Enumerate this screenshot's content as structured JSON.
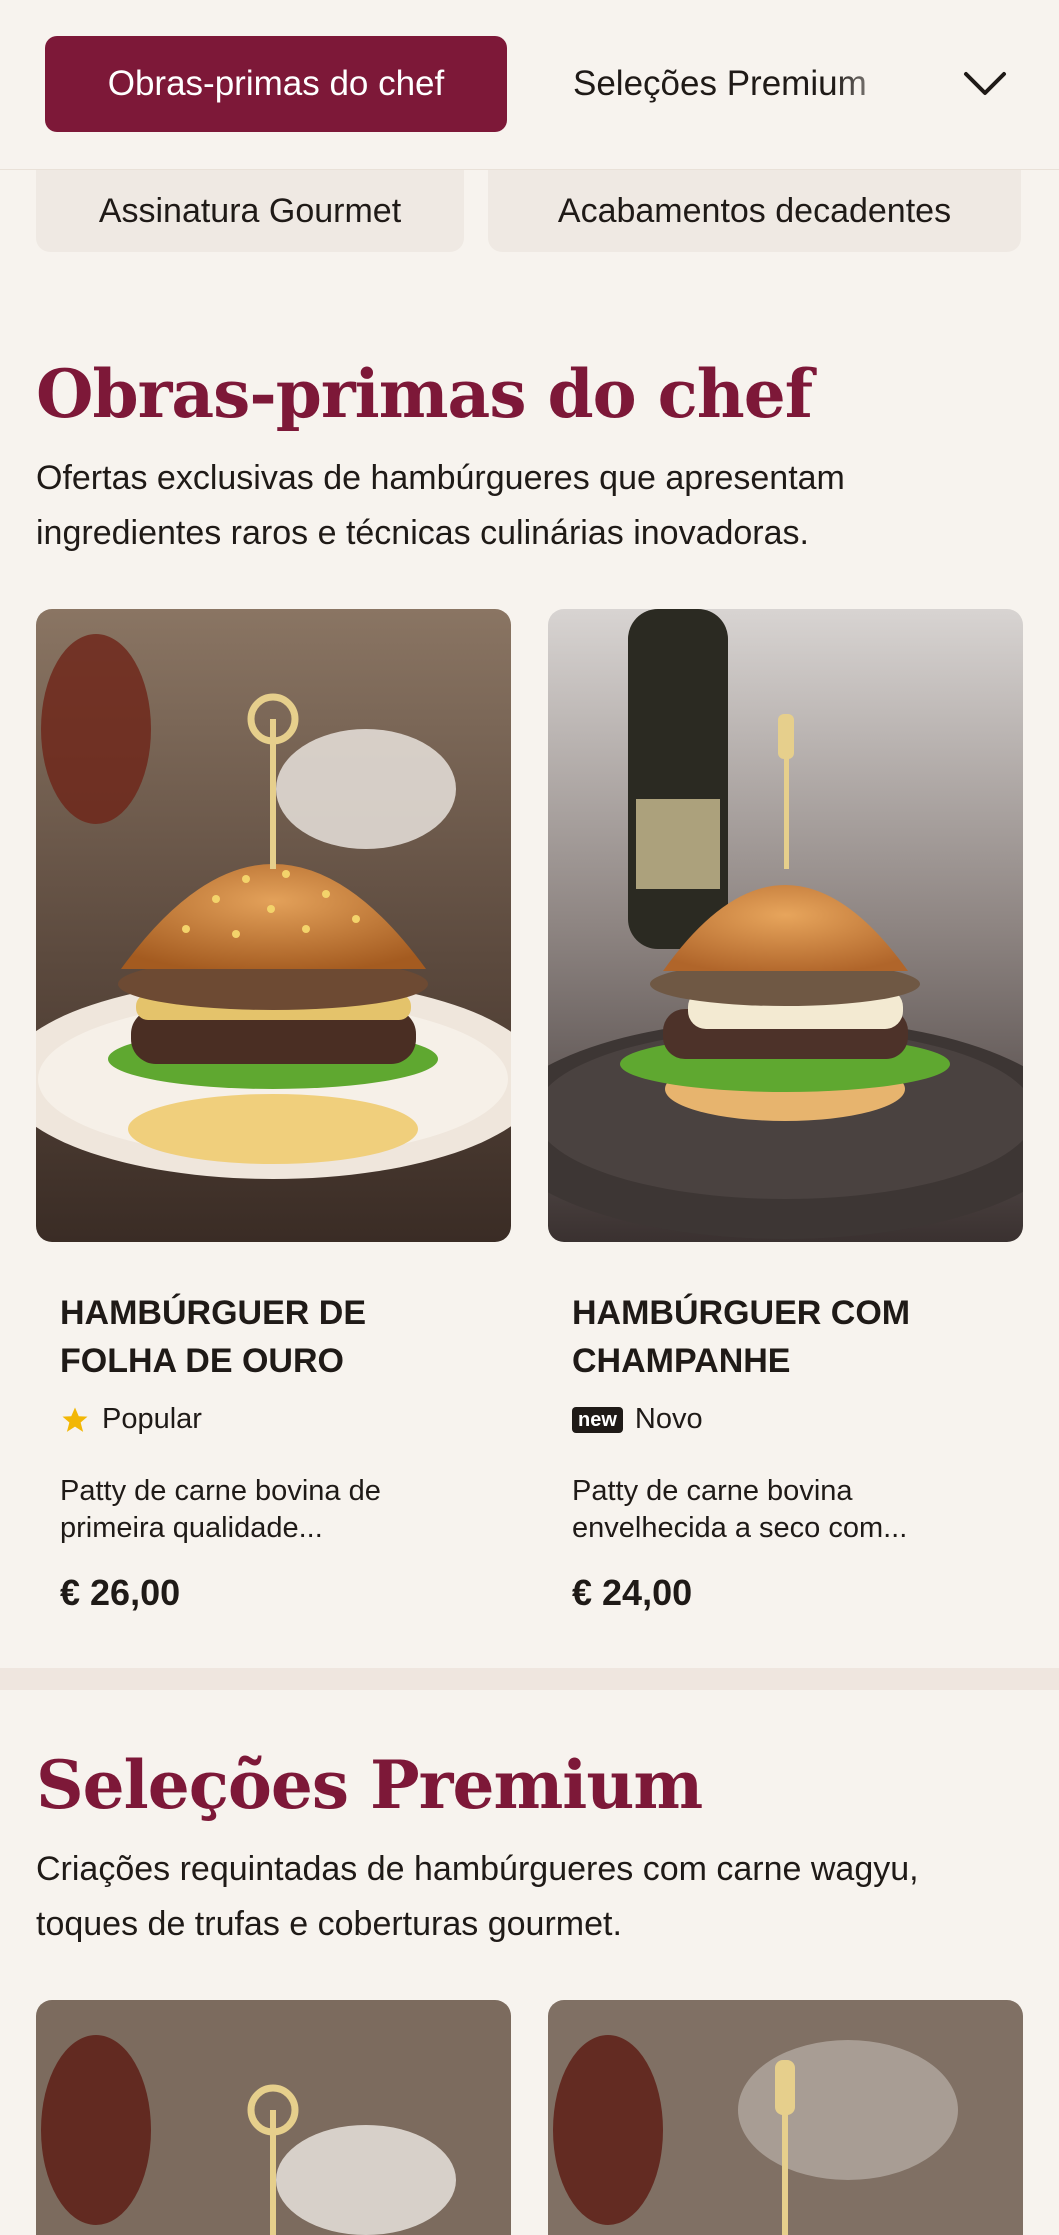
{
  "nav": {
    "active_tab": "Obras-primas do chef",
    "tab_next": "Seleções Premium",
    "dropdown_icon": "chevron-down-icon",
    "subtabs": [
      "Assinatura Gourmet",
      "Acabamentos decadentes"
    ]
  },
  "sections": [
    {
      "title": "Obras-primas do chef",
      "description": "Ofertas exclusivas de hambúrgueres que apresentam ingredientes raros e técnicas culinárias inovadoras.",
      "products": [
        {
          "name": "HAMBÚRGUER DE FOLHA DE OURO",
          "badge_icon": "star-icon",
          "badge_text": "Popular",
          "description": "Patty de carne bovina de primeira qualidade...",
          "price": "€ 26,00"
        },
        {
          "name": "HAMBÚRGUER COM CHAMPANHE",
          "badge_icon": "new-tag-icon",
          "badge_tag": "new",
          "badge_text": "Novo",
          "description": "Patty de carne bovina envelhecida a seco com...",
          "price": "€ 24,00"
        }
      ]
    },
    {
      "title": "Seleções Premium",
      "description": "Criações requintadas de hambúrgueres com carne wagyu, toques de trufas e coberturas gourmet."
    }
  ],
  "colors": {
    "brand": "#7d1838",
    "background": "#f7f3ee",
    "pill": "#efe9e3",
    "star": "#f2b705"
  }
}
